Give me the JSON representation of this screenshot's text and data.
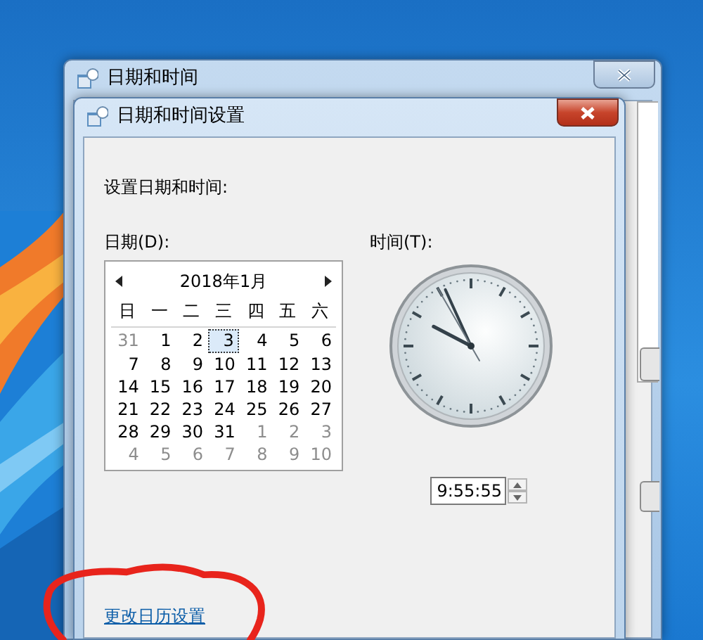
{
  "outer_window": {
    "title": "日期和时间"
  },
  "dialog": {
    "title": "日期和时间设置",
    "heading": "设置日期和时间:",
    "date_label": "日期(D):",
    "time_label": "时间(T):",
    "calendar": {
      "month": "2018年1月",
      "weekdays": [
        "日",
        "一",
        "二",
        "三",
        "四",
        "五",
        "六"
      ],
      "days": [
        {
          "day": "31",
          "other_month": true,
          "selected": false
        },
        {
          "day": "1",
          "other_month": false,
          "selected": false
        },
        {
          "day": "2",
          "other_month": false,
          "selected": false
        },
        {
          "day": "3",
          "other_month": false,
          "selected": true
        },
        {
          "day": "4",
          "other_month": false,
          "selected": false
        },
        {
          "day": "5",
          "other_month": false,
          "selected": false
        },
        {
          "day": "6",
          "other_month": false,
          "selected": false
        },
        {
          "day": "7",
          "other_month": false,
          "selected": false
        },
        {
          "day": "8",
          "other_month": false,
          "selected": false
        },
        {
          "day": "9",
          "other_month": false,
          "selected": false
        },
        {
          "day": "10",
          "other_month": false,
          "selected": false
        },
        {
          "day": "11",
          "other_month": false,
          "selected": false
        },
        {
          "day": "12",
          "other_month": false,
          "selected": false
        },
        {
          "day": "13",
          "other_month": false,
          "selected": false
        },
        {
          "day": "14",
          "other_month": false,
          "selected": false
        },
        {
          "day": "15",
          "other_month": false,
          "selected": false
        },
        {
          "day": "16",
          "other_month": false,
          "selected": false
        },
        {
          "day": "17",
          "other_month": false,
          "selected": false
        },
        {
          "day": "18",
          "other_month": false,
          "selected": false
        },
        {
          "day": "19",
          "other_month": false,
          "selected": false
        },
        {
          "day": "20",
          "other_month": false,
          "selected": false
        },
        {
          "day": "21",
          "other_month": false,
          "selected": false
        },
        {
          "day": "22",
          "other_month": false,
          "selected": false
        },
        {
          "day": "23",
          "other_month": false,
          "selected": false
        },
        {
          "day": "24",
          "other_month": false,
          "selected": false
        },
        {
          "day": "25",
          "other_month": false,
          "selected": false
        },
        {
          "day": "26",
          "other_month": false,
          "selected": false
        },
        {
          "day": "27",
          "other_month": false,
          "selected": false
        },
        {
          "day": "28",
          "other_month": false,
          "selected": false
        },
        {
          "day": "29",
          "other_month": false,
          "selected": false
        },
        {
          "day": "30",
          "other_month": false,
          "selected": false
        },
        {
          "day": "31",
          "other_month": false,
          "selected": false
        },
        {
          "day": "1",
          "other_month": true,
          "selected": false
        },
        {
          "day": "2",
          "other_month": true,
          "selected": false
        },
        {
          "day": "3",
          "other_month": true,
          "selected": false
        },
        {
          "day": "4",
          "other_month": true,
          "selected": false
        },
        {
          "day": "5",
          "other_month": true,
          "selected": false
        },
        {
          "day": "6",
          "other_month": true,
          "selected": false
        },
        {
          "day": "7",
          "other_month": true,
          "selected": false
        },
        {
          "day": "8",
          "other_month": true,
          "selected": false
        },
        {
          "day": "9",
          "other_month": true,
          "selected": false
        },
        {
          "day": "10",
          "other_month": true,
          "selected": false
        }
      ]
    },
    "time": "9:55:55",
    "link": "更改日历设置"
  }
}
